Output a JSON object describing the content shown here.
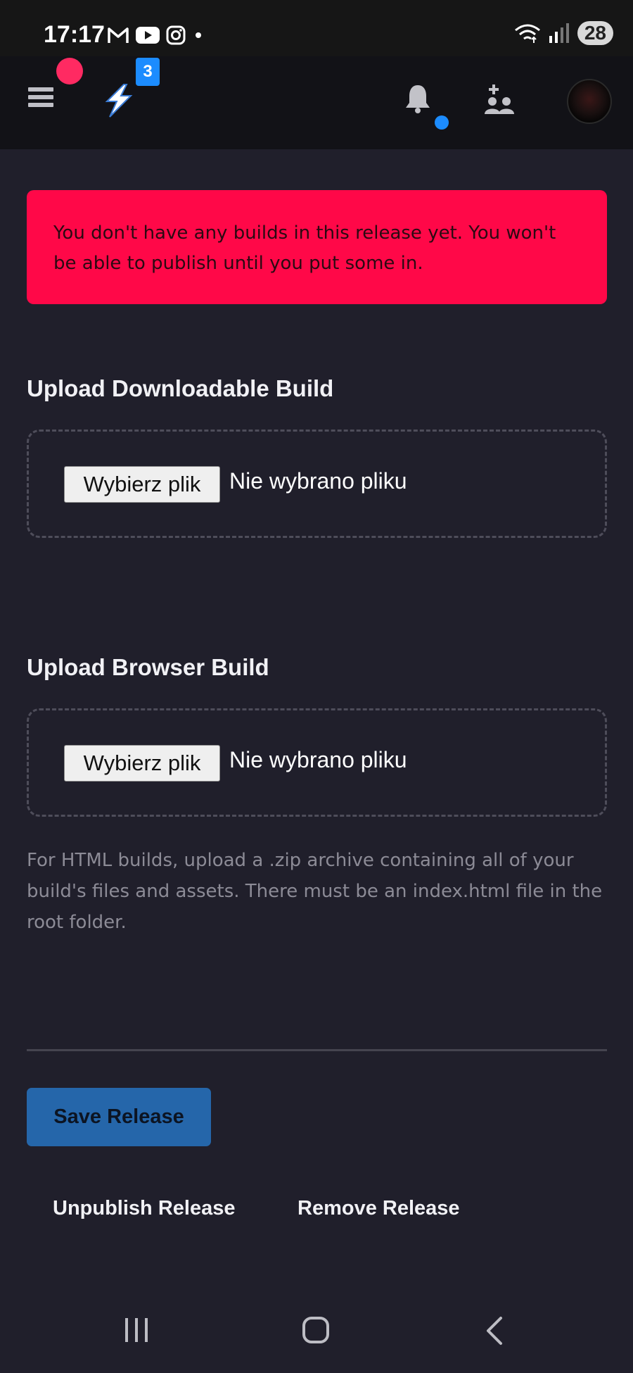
{
  "status_bar": {
    "time": "17:17",
    "notification_icons": [
      "gmail-icon",
      "youtube-icon",
      "instagram-icon",
      "dot-icon"
    ],
    "system_icons": [
      "wifi-icon",
      "signal-icon"
    ],
    "battery": "28"
  },
  "topnav": {
    "menu_icon": "hamburger-icon",
    "logo_badge": "3",
    "icons": [
      "bell-icon",
      "add-friend-icon",
      "avatar"
    ],
    "colors": {
      "red_dot": "#ff2a62",
      "blue_badge": "#1c8cff"
    }
  },
  "alert": {
    "text": "You don't have any builds in this release yet. You won't be able to publish until you put some in.",
    "color": "#ff0848"
  },
  "downloadable": {
    "heading": "Upload Downloadable Build",
    "button": "Wybierz plik",
    "status": "Nie wybrano pliku"
  },
  "browser": {
    "heading": "Upload Browser Build",
    "button": "Wybierz plik",
    "status": "Nie wybrano pliku",
    "help": "For HTML builds, upload a .zip archive containing all of your build's files and assets. There must be an index.html file in the root folder."
  },
  "actions": {
    "save": "Save Release",
    "unpublish": "Unpublish Release",
    "remove": "Remove Release",
    "save_color": "#2566aa"
  },
  "android_nav": [
    "recents-icon",
    "home-icon",
    "back-icon"
  ]
}
